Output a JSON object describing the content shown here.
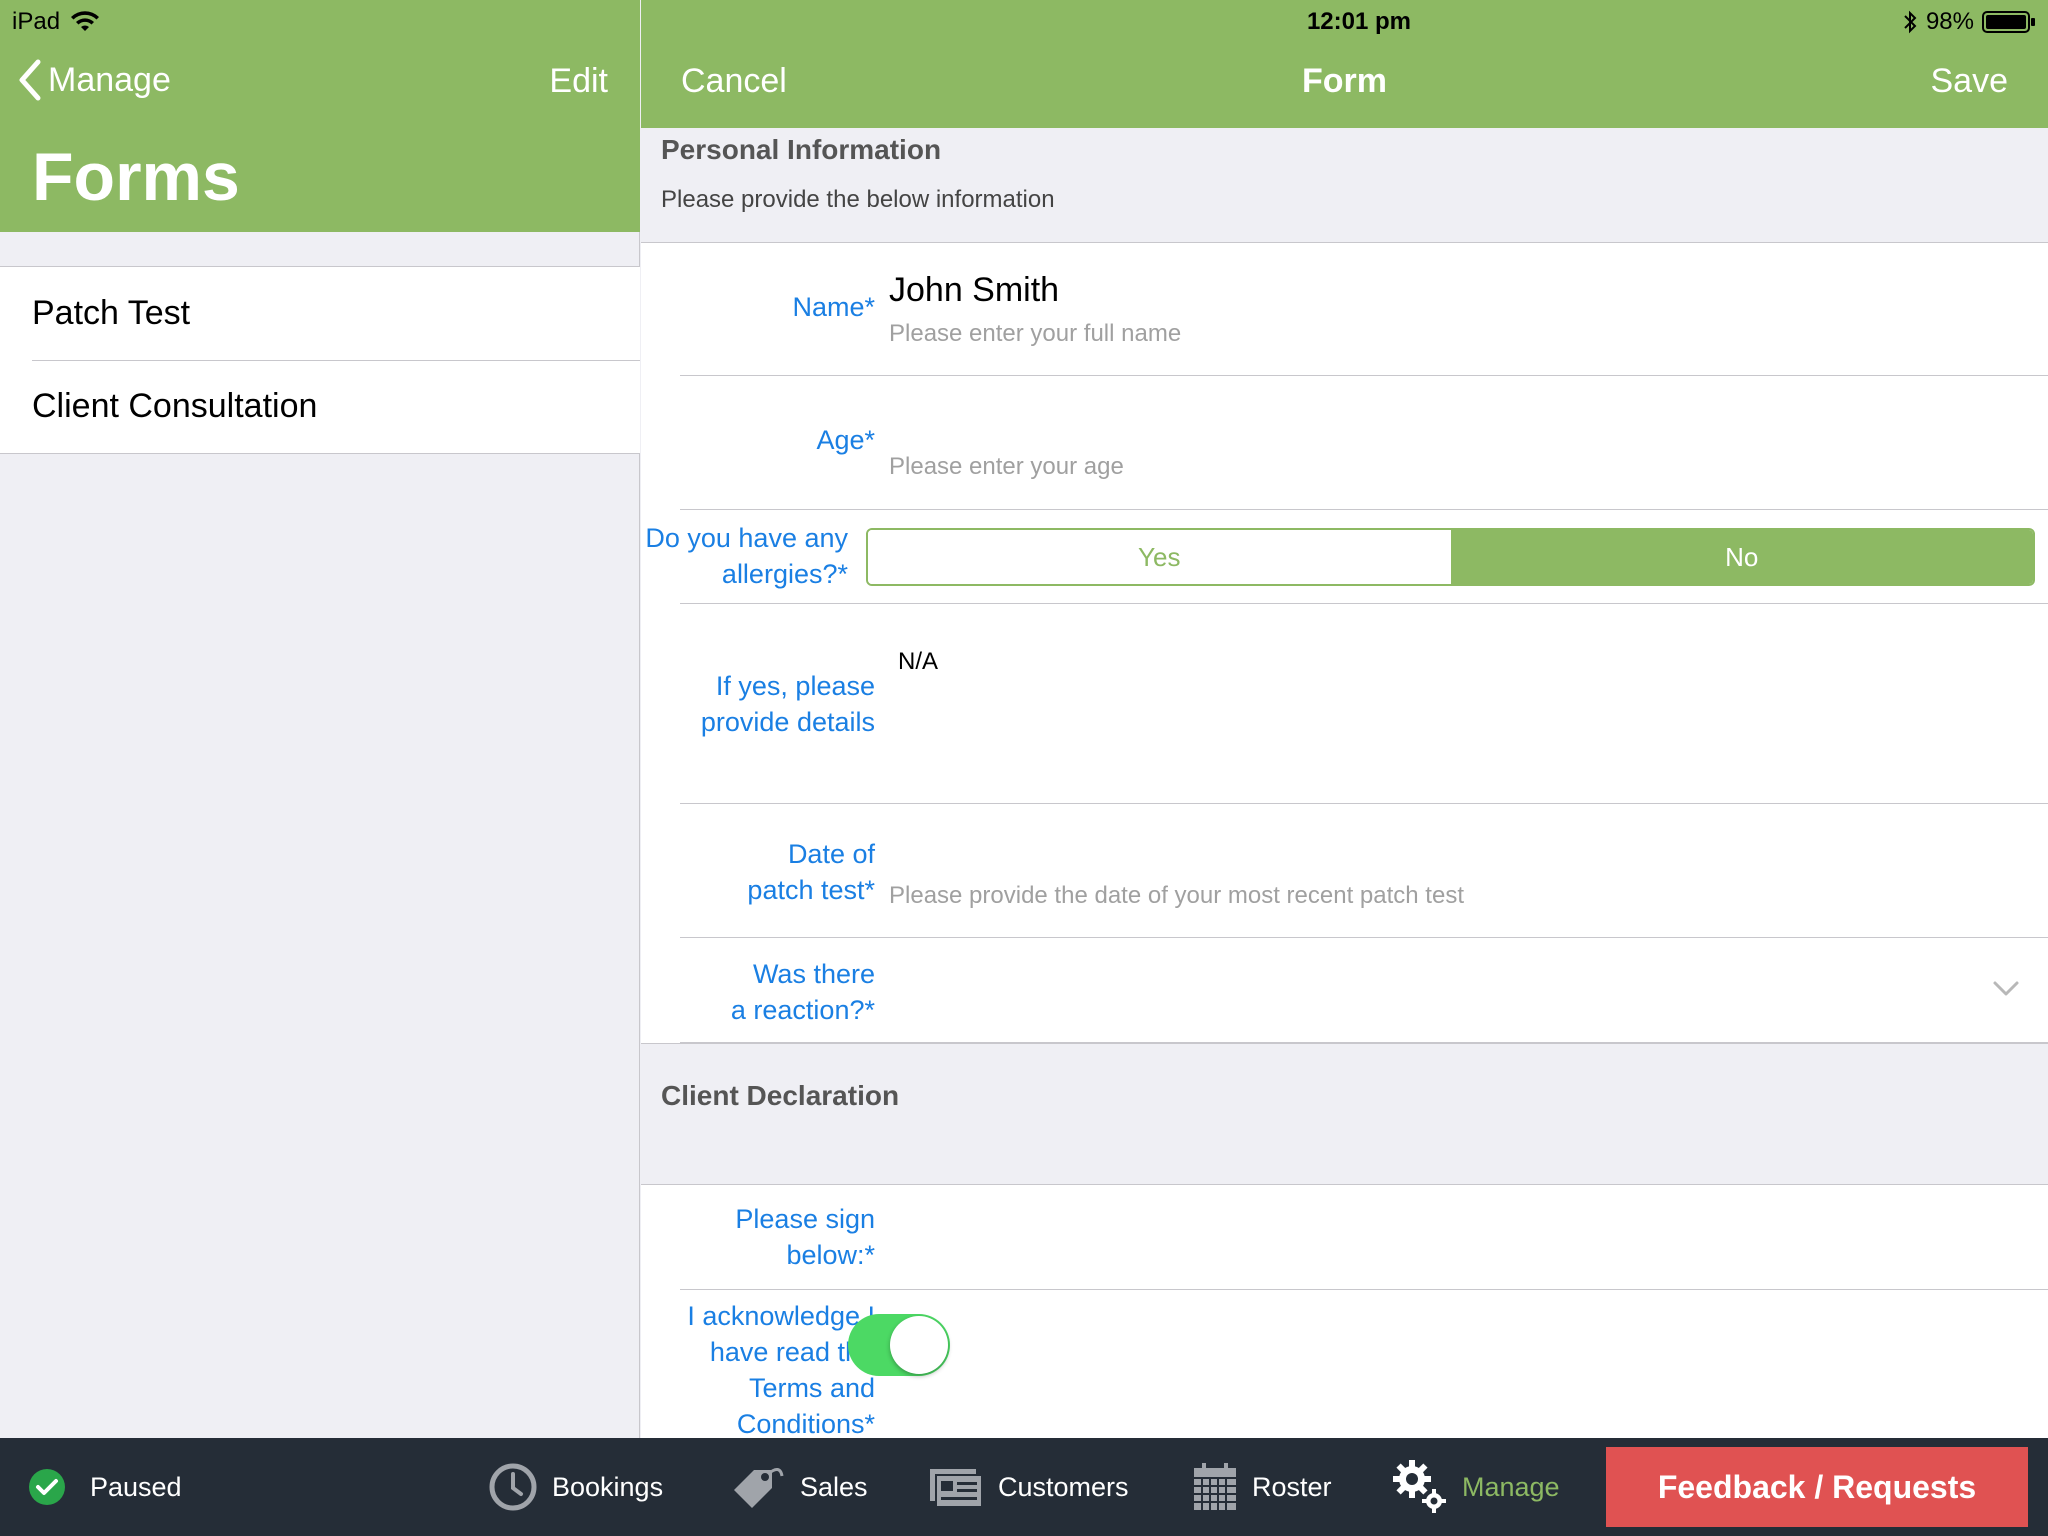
{
  "status_bar": {
    "device": "iPad",
    "time": "12:01 pm",
    "battery": "98%"
  },
  "sidebar": {
    "back_label": "Manage",
    "edit_label": "Edit",
    "title": "Forms",
    "items": [
      {
        "label": "Patch Test"
      },
      {
        "label": "Client Consultation"
      }
    ]
  },
  "form_nav": {
    "cancel_label": "Cancel",
    "title": "Form",
    "save_label": "Save"
  },
  "sections": {
    "personal": {
      "title": "Personal Information",
      "subtitle": "Please provide the below information"
    },
    "declaration": {
      "title": "Client Declaration"
    }
  },
  "fields": {
    "name": {
      "label": "Name*",
      "value": "John Smith",
      "placeholder": "Please enter your full name"
    },
    "age": {
      "label": "Age*",
      "placeholder": "Please enter your age"
    },
    "allergies": {
      "label_line1": "Do you have any",
      "label_line2": "allergies?*",
      "options": [
        "Yes",
        "No"
      ],
      "selected": "No"
    },
    "details": {
      "label_line1": "If yes, please",
      "label_line2": "provide details",
      "value": "N/A"
    },
    "patch_date": {
      "label_line1": "Date of",
      "label_line2": "patch test*",
      "placeholder": "Please provide the date of your most recent patch test"
    },
    "reaction": {
      "label_line1": "Was there",
      "label_line2": "a reaction?*"
    },
    "sign": {
      "label_line1": "Please sign",
      "label_line2": "below:*"
    },
    "terms": {
      "label_line1": "I acknowledge I",
      "label_line2": "have read the",
      "label_line3": "Terms and",
      "label_line4": "Conditions*",
      "checked": true
    }
  },
  "tabbar": {
    "status_label": "Paused",
    "tabs": [
      {
        "label": "Bookings",
        "icon": "clock-icon"
      },
      {
        "label": "Sales",
        "icon": "tag-icon"
      },
      {
        "label": "Customers",
        "icon": "cards-icon"
      },
      {
        "label": "Roster",
        "icon": "calendar-icon"
      },
      {
        "label": "Manage",
        "icon": "gears-icon",
        "active": true
      }
    ],
    "feedback_label": "Feedback / Requests"
  },
  "colors": {
    "brand": "#8db963",
    "link": "#1a7fe3",
    "toggle_on": "#4cd964",
    "feedback": "#e05252",
    "tabbar": "#252d37"
  }
}
